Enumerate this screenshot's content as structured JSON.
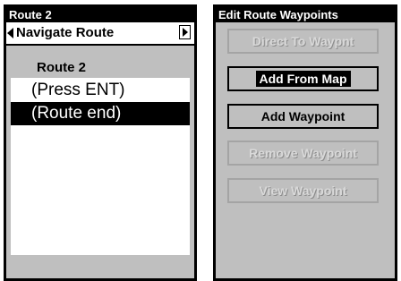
{
  "left": {
    "title": "Route 2",
    "nav_label": "Navigate Route",
    "list_header": "Route 2",
    "items": [
      "(Press ENT)",
      "(Route end)"
    ]
  },
  "right": {
    "title": "Edit Route Waypoints",
    "buttons": [
      {
        "label": "Direct To Waypnt",
        "state": "disabled"
      },
      {
        "label": "Add From Map",
        "state": "focused"
      },
      {
        "label": "Add Waypoint",
        "state": "enabled"
      },
      {
        "label": "Remove Waypoint",
        "state": "disabled"
      },
      {
        "label": "View Waypoint",
        "state": "disabled"
      }
    ]
  },
  "colors": {
    "panel": "#bfbfbf",
    "selection": "#000000",
    "disabled_text": "#d9d9d9"
  },
  "icons": [
    "arrow-left-icon",
    "arrow-right-icon"
  ]
}
